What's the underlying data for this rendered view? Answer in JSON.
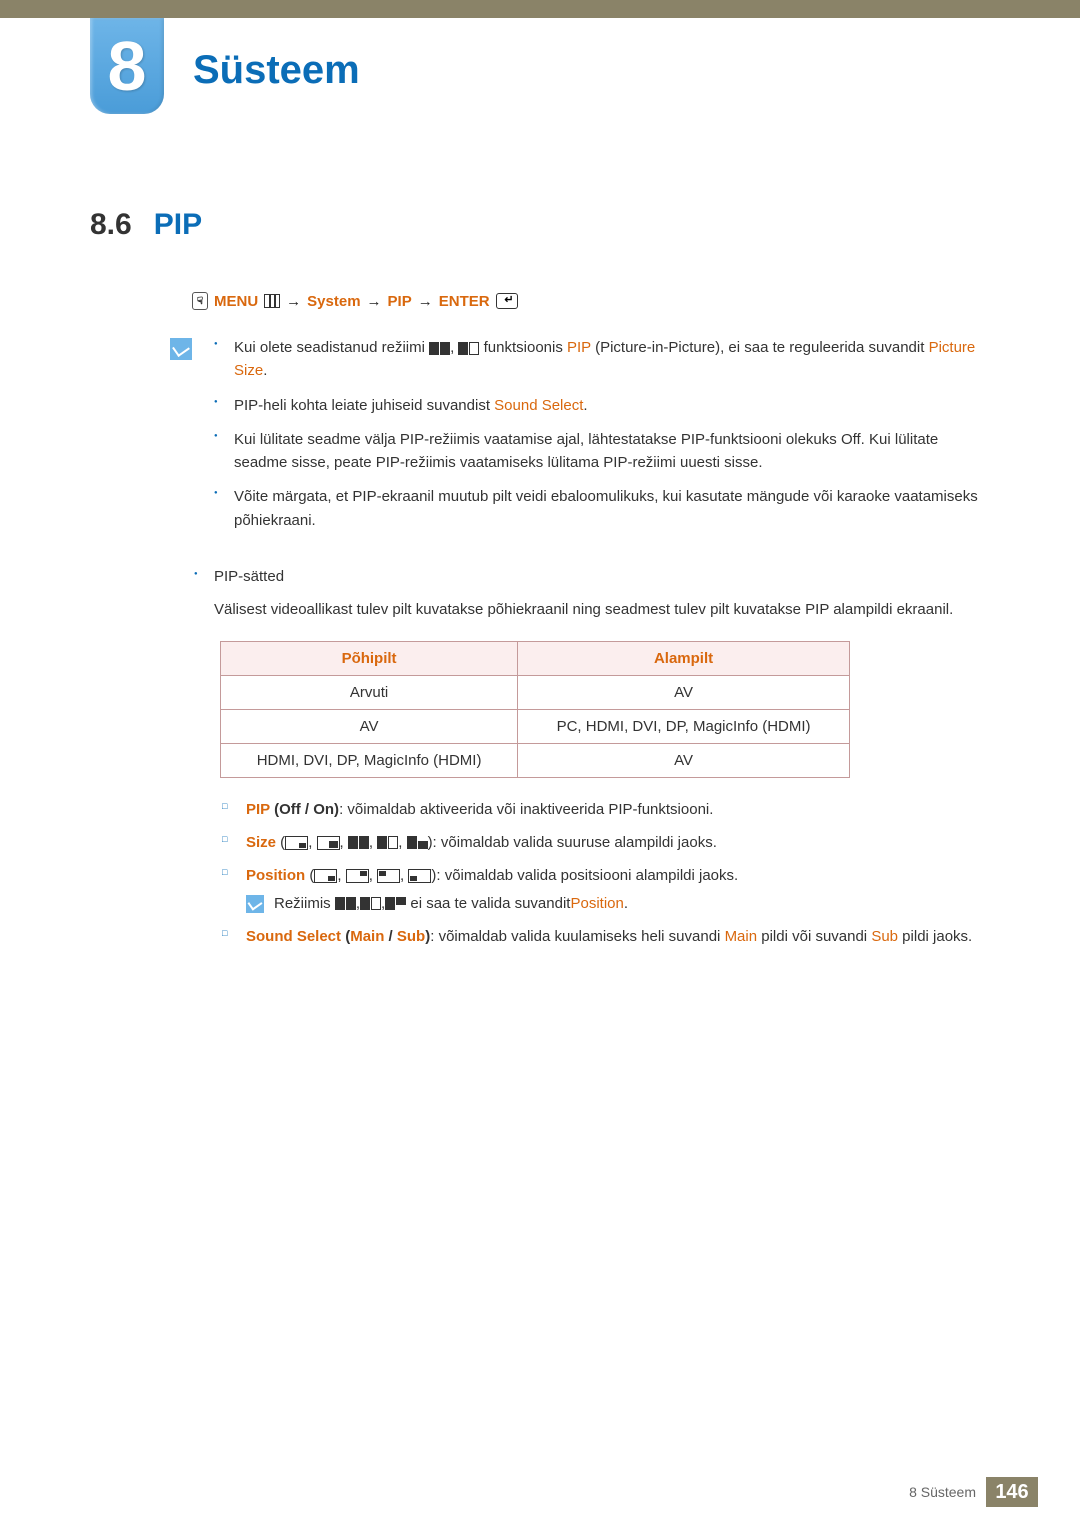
{
  "chapter": {
    "number": "8",
    "title": "Süsteem"
  },
  "section": {
    "number": "8.6",
    "title": "PIP"
  },
  "menuPath": {
    "menu": "MENU",
    "arrow": "→",
    "system": "System",
    "pip": "PIP",
    "enter": "ENTER"
  },
  "notes": {
    "n1a": "Kui olete seadistanud režiimi ",
    "n1b": " funktsioonis ",
    "n1c": "PIP",
    "n1d": " (Picture-in-Picture), ei saa te reguleerida suvandit ",
    "n1e": "Picture Size",
    "n2a": "PIP-heli kohta leiate juhiseid suvandist ",
    "n2b": "Sound Select",
    "n3": "Kui lülitate seadme välja PIP-režiimis vaatamise ajal, lähtestatakse PIP-funktsiooni olekuks Off. Kui lülitate seadme sisse, peate PIP-režiimis vaatamiseks lülitama PIP-režiimi uuesti sisse.",
    "n4": "Võite märgata, et PIP-ekraanil muutub pilt veidi ebaloomulikuks, kui kasutate mängude või karaoke vaatamiseks põhiekraani."
  },
  "pipSettings": {
    "title": "PIP-sätted",
    "desc": "Välisest videoallikast tulev pilt kuvatakse põhiekraanil ning seadmest tulev pilt kuvatakse PIP alampildi ekraanil."
  },
  "table": {
    "h1": "Põhipilt",
    "h2": "Alampilt",
    "rows": [
      {
        "c1": "Arvuti",
        "c2": "AV"
      },
      {
        "c1": "AV",
        "c2": "PC, HDMI, DVI, DP, MagicInfo (HDMI)"
      },
      {
        "c1": "HDMI, DVI, DP, MagicInfo (HDMI)",
        "c2": "AV"
      }
    ]
  },
  "options": {
    "pip": {
      "label": "PIP",
      "vals": " (Off / On)",
      "desc": ": võimaldab aktiveerida või inaktiveerida PIP-funktsiooni."
    },
    "size": {
      "label": "Size",
      "desc": "): võimaldab valida suuruse alampildi jaoks."
    },
    "position": {
      "label": "Position",
      "desc": "): võimaldab valida positsiooni alampildi jaoks."
    },
    "positionNote1": "Režiimis ",
    "positionNote2": " ei saa te valida suvandit ",
    "positionNote3": "Position",
    "sound": {
      "label": "Sound Select",
      "vals1": " (",
      "main": "Main",
      "sep": " / ",
      "sub": "Sub",
      "vals2": ")",
      "desc1": ": võimaldab valida kuulamiseks heli suvandi ",
      "desc2": " pildi või suvandi ",
      "desc3": " pildi jaoks."
    }
  },
  "footer": {
    "text": "8 Süsteem",
    "page": "146"
  }
}
